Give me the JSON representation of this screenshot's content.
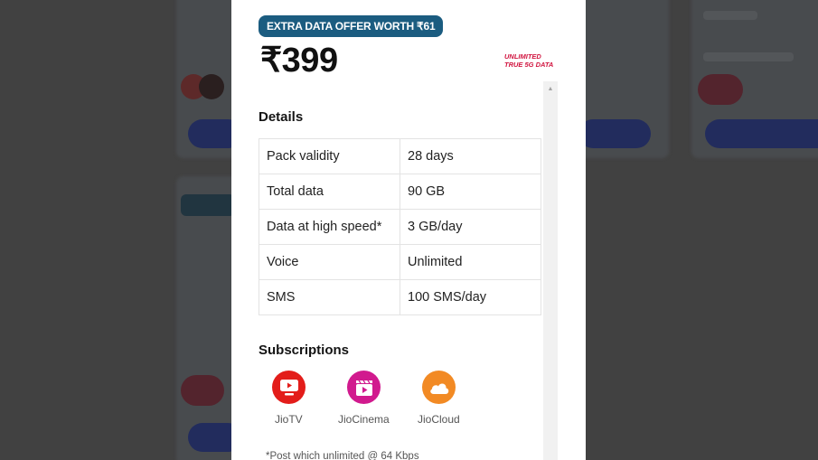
{
  "modal": {
    "offer_badge": "EXTRA DATA OFFER WORTH ₹61",
    "price": "₹399",
    "tag_line1": "UNLIMITED",
    "tag_line2": "TRUE 5G DATA",
    "details_title": "Details",
    "details": [
      {
        "label": "Pack validity",
        "value": "28 days"
      },
      {
        "label": "Total data",
        "value": "90 GB"
      },
      {
        "label": "Data at high speed*",
        "value": "3 GB/day"
      },
      {
        "label": "Voice",
        "value": "Unlimited"
      },
      {
        "label": "SMS",
        "value": "100 SMS/day"
      }
    ],
    "subscriptions_title": "Subscriptions",
    "subscriptions": [
      {
        "label": "JioTV",
        "icon": "tv-icon",
        "color": "#e31d1a"
      },
      {
        "label": "JioCinema",
        "icon": "clapperboard-icon",
        "color": "#d11a8e"
      },
      {
        "label": "JioCloud",
        "icon": "cloud-icon",
        "color": "#f28a24"
      }
    ],
    "footnote": "*Post which unlimited @ 64 Kbps"
  },
  "colors": {
    "badge_bg": "#1b5c80",
    "tag_red": "#d1143f",
    "overlay_bg": "#4f4f4f",
    "background_button": "#1f2f7a"
  }
}
